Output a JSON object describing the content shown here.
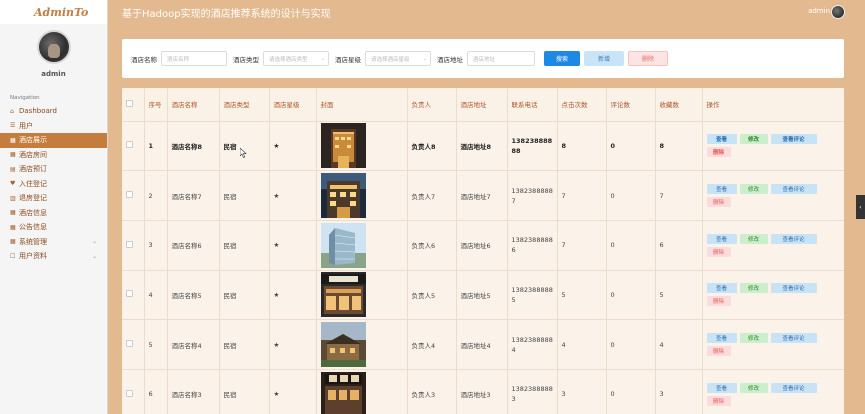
{
  "brand": "AdminTo",
  "header": {
    "title": "基于Hadoop实现的酒店推荐系统的设计与实现",
    "user": "admin"
  },
  "sidebar": {
    "username": "admin",
    "nav_title": "Navigation",
    "items": [
      {
        "icon": "home-icon",
        "label": "Dashboard",
        "active": false
      },
      {
        "icon": "list-icon",
        "label": "用户",
        "active": false
      },
      {
        "icon": "grid-icon",
        "label": "酒店展示",
        "active": true
      },
      {
        "icon": "grid-icon",
        "label": "酒店房间",
        "active": false
      },
      {
        "icon": "book-icon",
        "label": "酒店预订",
        "active": false
      },
      {
        "icon": "heart-icon",
        "label": "入住登记",
        "active": false
      },
      {
        "icon": "chart-icon",
        "label": "退房登记",
        "active": false
      },
      {
        "icon": "grid-icon",
        "label": "酒店信息",
        "active": false
      },
      {
        "icon": "grid-icon",
        "label": "公告信息",
        "active": false
      },
      {
        "icon": "grid-icon",
        "label": "系统管理",
        "active": false,
        "expandable": true
      },
      {
        "icon": "user-icon",
        "label": "用户资料",
        "active": false,
        "expandable": true
      }
    ]
  },
  "search": {
    "name_label": "酒店名称",
    "name_placeholder": "酒店名称",
    "type_label": "酒店类型",
    "type_placeholder": "请选择酒店类型",
    "star_label": "酒店星级",
    "star_placeholder": "请选择酒店星级",
    "addr_label": "酒店地址",
    "addr_placeholder": "酒店地址",
    "search_btn": "搜索",
    "add_btn": "新增",
    "delete_btn": "删除"
  },
  "table": {
    "headers": [
      "序号",
      "酒店名称",
      "酒店类型",
      "酒店星级",
      "封面",
      "负责人",
      "酒店地址",
      "联系电话",
      "点击次数",
      "评论数",
      "收藏数",
      "操作"
    ],
    "op_labels": {
      "view": "查看",
      "edit": "修改",
      "comments": "查看评论",
      "delete": "删除"
    },
    "rows": [
      {
        "idx": "1",
        "name": "酒店名称8",
        "type": "民宿",
        "star": "★",
        "owner": "负责人8",
        "addr": "酒店地址8",
        "tel": "13823888888",
        "clicks": "8",
        "comments": "0",
        "favs": "8",
        "bold": true
      },
      {
        "idx": "2",
        "name": "酒店名称7",
        "type": "民宿",
        "star": "★",
        "owner": "负责人7",
        "addr": "酒店地址7",
        "tel": "13823888887",
        "clicks": "7",
        "comments": "0",
        "favs": "7",
        "bold": false
      },
      {
        "idx": "3",
        "name": "酒店名称6",
        "type": "民宿",
        "star": "★",
        "owner": "负责人6",
        "addr": "酒店地址6",
        "tel": "13823888886",
        "clicks": "7",
        "comments": "0",
        "favs": "6",
        "bold": false
      },
      {
        "idx": "4",
        "name": "酒店名称5",
        "type": "民宿",
        "star": "★",
        "owner": "负责人5",
        "addr": "酒店地址5",
        "tel": "13823888885",
        "clicks": "5",
        "comments": "0",
        "favs": "5",
        "bold": false
      },
      {
        "idx": "5",
        "name": "酒店名称4",
        "type": "民宿",
        "star": "★",
        "owner": "负责人4",
        "addr": "酒店地址4",
        "tel": "13823888884",
        "clicks": "4",
        "comments": "0",
        "favs": "4",
        "bold": false
      },
      {
        "idx": "6",
        "name": "酒店名称3",
        "type": "民宿",
        "star": "★",
        "owner": "负责人3",
        "addr": "酒店地址3",
        "tel": "13823888883",
        "clicks": "3",
        "comments": "0",
        "favs": "3",
        "bold": false
      }
    ]
  },
  "colors": {
    "header_bg": "#e3b98f",
    "active_nav": "#c47d3c",
    "accent": "#b0562a",
    "primary_button": "#1e88e5"
  }
}
